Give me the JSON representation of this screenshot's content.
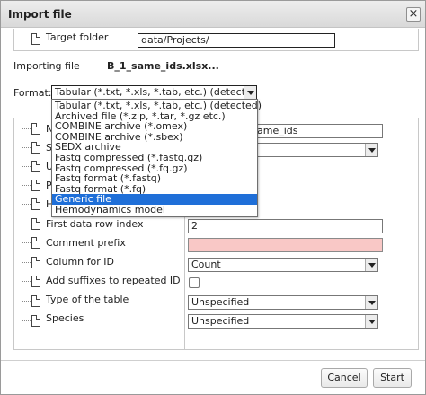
{
  "dialog": {
    "title": "Import file",
    "close_glyph": "×"
  },
  "target": {
    "label": "Target folder",
    "value": "data/Projects/"
  },
  "importing": {
    "label": "Importing file",
    "value": "B_1_same_ids.xlsx..."
  },
  "format": {
    "label": "Format:",
    "selected": "Tabular (*.txt, *.xls, *.tab, etc.) (detected)",
    "options": [
      "Tabular (*.txt, *.xls, *.tab, etc.) (detected)",
      "Archived file (*.zip, *.tar, *.gz etc.)",
      "COMBINE archive (*.omex)",
      "COMBINE archive (*.sbex)",
      "SEDX archive",
      "Fastq compressed (*.fastq.gz)",
      "Fastq compressed (*.fq.gz)",
      "Fastq format (*.fastq)",
      "Fastq format (*.fq)",
      "Generic file",
      "Hemodynamics model"
    ],
    "highlighted_index": 9
  },
  "properties": {
    "partial_labels": [
      "N",
      "S",
      "U",
      "P",
      "H"
    ],
    "name_value_fragment": "ame_ids",
    "rows": [
      {
        "label": "First data row index",
        "value": "2"
      },
      {
        "label": "Comment prefix",
        "value": ""
      },
      {
        "label": "Column for ID",
        "value": "Count"
      },
      {
        "label": "Add suffixes to repeated ID",
        "value": ""
      },
      {
        "label": "Type of the table",
        "value": "Unspecified"
      },
      {
        "label": "Species",
        "value": "Unspecified"
      }
    ]
  },
  "buttons": {
    "cancel": "Cancel",
    "start": "Start"
  },
  "colors": {
    "invalid_field": "#f9c8c6",
    "highlight": "#1f6fd8"
  }
}
